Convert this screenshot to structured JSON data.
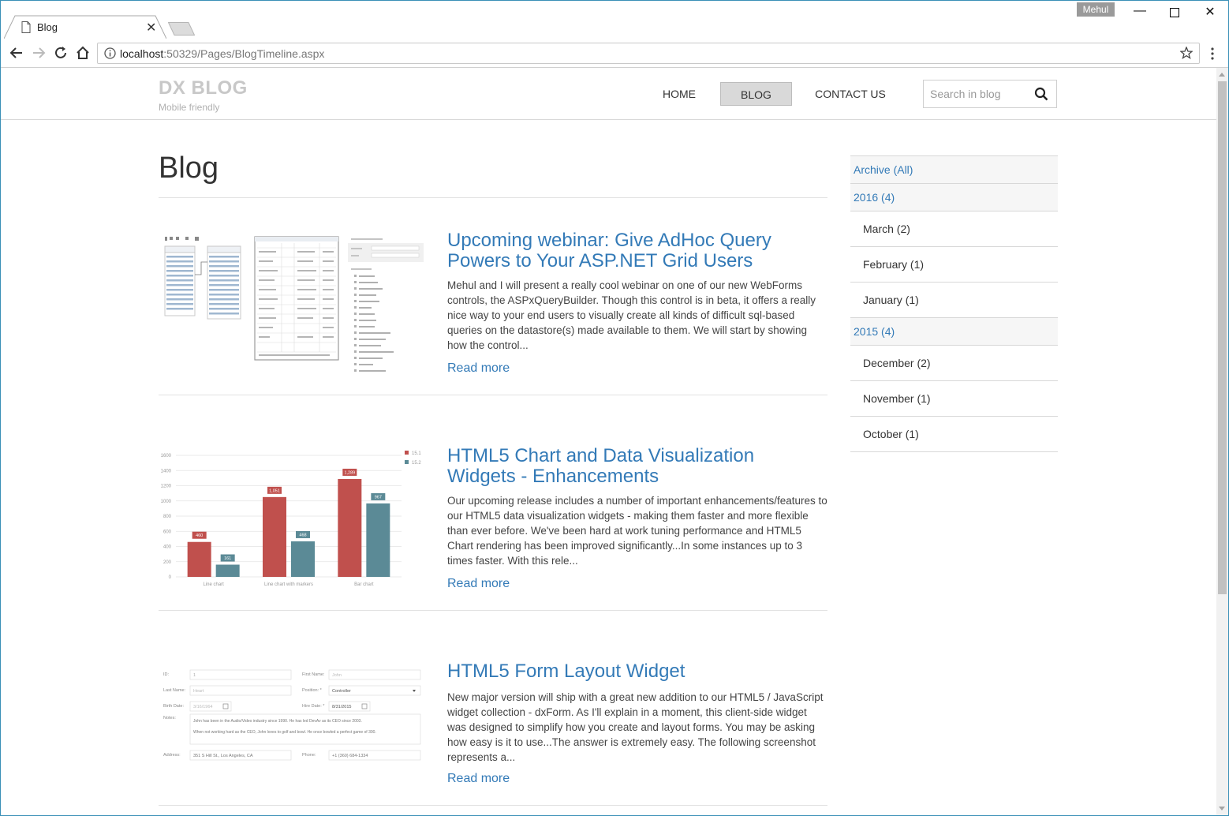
{
  "browser": {
    "tab_title": "Blog",
    "profile_name": "Mehul",
    "url_host": "localhost",
    "url_rest": ":50329/Pages/BlogTimeline.aspx"
  },
  "site": {
    "brand": "DX BLOG",
    "tagline": "Mobile friendly",
    "nav": [
      {
        "label": "HOME"
      },
      {
        "label": "BLOG"
      },
      {
        "label": "CONTACT US"
      }
    ],
    "search_placeholder": "Search in blog"
  },
  "page": {
    "title": "Blog"
  },
  "posts": [
    {
      "title": "Upcoming webinar: Give AdHoc Query Powers to Your ASP.NET Grid Users",
      "excerpt": "Mehul and I will present a really cool webinar on one of our new WebForms controls, the ASPxQueryBuilder. Though this control is in beta, it offers a really nice way to your end users to visually create all kinds of difficult sql-based queries on the datastore(s) made available to them. We will start by showing how the control...",
      "read_more": "Read more"
    },
    {
      "title": "HTML5 Chart and Data Visualization Widgets - Enhancements",
      "excerpt": "Our upcoming release includes a number of important enhancements/features to our HTML5 data visualization widgets - making them faster and more flexible than ever before. We've been hard at work tuning performance and HTML5 Chart rendering has been improved significantly...In some instances up to 3 times faster. With this rele...",
      "read_more": "Read more"
    },
    {
      "title": "HTML5 Form Layout Widget",
      "excerpt": "New major version will ship with a great new addition to our HTML5 / JavaScript widget collection - dxForm. As I'll explain in a moment, this client-side widget was designed to simplify how you create and layout forms. You may be asking how easy is it to use...The answer is extremely easy. The following screenshot represents a...",
      "read_more": "Read more"
    }
  ],
  "archive": {
    "all_label": "Archive (All)",
    "years": [
      {
        "label": "2016 (4)",
        "months": [
          "March (2)",
          "February (1)",
          "January (1)"
        ]
      },
      {
        "label": "2015 (4)",
        "months": [
          "December (2)",
          "November (1)",
          "October (1)"
        ]
      }
    ]
  },
  "chart_data": {
    "type": "bar",
    "categories": [
      "Line chart",
      "Line chart with markers",
      "Bar chart"
    ],
    "series": [
      {
        "name": "15.1",
        "values": [
          460,
          1051,
          1289
        ],
        "color": "#c0504d"
      },
      {
        "name": "15.2",
        "values": [
          161,
          468,
          967
        ],
        "color": "#5b8a96"
      }
    ],
    "yticks": [
      0,
      200,
      400,
      600,
      800,
      1000,
      1200,
      1400,
      1600
    ],
    "ylim": [
      0,
      1600
    ],
    "legend": "top-right",
    "grid": true
  },
  "form_preview": {
    "labels": {
      "id": "ID:",
      "first_name": "First Name:",
      "last_name": "Last Name:",
      "position": "Position: *",
      "birth_date": "Birth Date:",
      "hire_date": "Hire Date: *",
      "notes": "Notes:",
      "address": "Address:",
      "phone": "Phone:"
    },
    "values": {
      "id": "1",
      "first_name": "John",
      "last_name": "Heart",
      "position": "Controller",
      "birth_date": "3/16/1964",
      "hire_date": "8/31/2015",
      "notes_1": "John has been in the Audio/Video industry since 1990. He has led DevAv as its CEO since 2003.",
      "notes_2": "When not working hard as the CEO, John loves to golf and bowl. He once bowled a perfect game of 300.",
      "address": "351 S Hill St., Los Angeles, CA",
      "phone": "+1 (360) 684-1334"
    }
  }
}
